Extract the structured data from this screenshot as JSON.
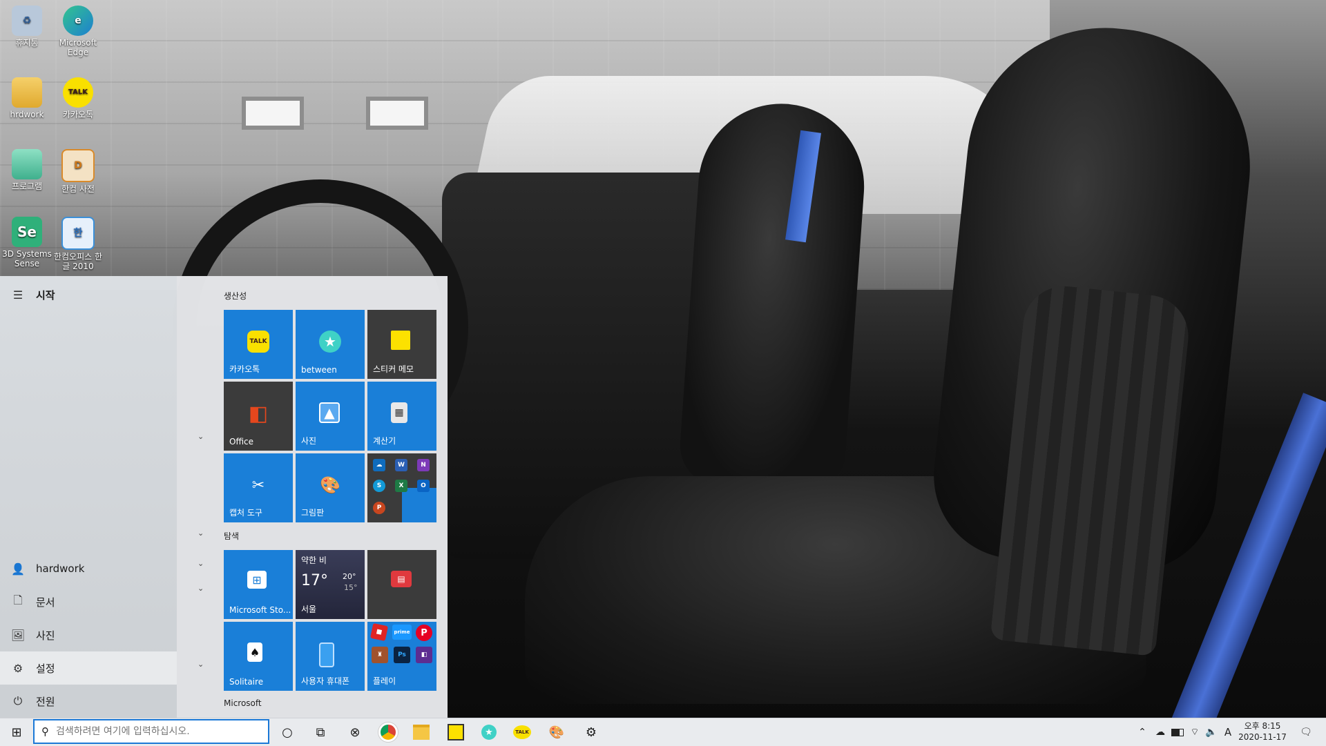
{
  "desktop": {
    "icons": [
      {
        "label": "휴지통",
        "glyph": "♻",
        "color": "#9fb7d3"
      },
      {
        "label": "Microsoft Edge",
        "glyph": "e",
        "color": "#1d7fcf"
      },
      {
        "label": "hrdwork",
        "glyph": "",
        "color": "#e7b948"
      },
      {
        "label": "카카오톡",
        "glyph": "TALK",
        "color": "#f9e000"
      },
      {
        "label": "프로그램",
        "glyph": "",
        "color": "#5cc6a7"
      },
      {
        "label": "한컴 사전",
        "glyph": "D",
        "color": "#d98a2a"
      },
      {
        "label": "3D Systems Sense",
        "glyph": "Se",
        "color": "#2fb07a"
      },
      {
        "label": "한컴오피스 한글 2010",
        "glyph": "한",
        "color": "#3a8fd8"
      }
    ]
  },
  "start_menu": {
    "header": {
      "label": "시작",
      "icon": "hamburger-icon"
    },
    "nav": [
      {
        "label": "hardwork",
        "icon": "user-icon"
      },
      {
        "label": "문서",
        "icon": "document-icon"
      },
      {
        "label": "사진",
        "icon": "pictures-icon"
      },
      {
        "label": "설정",
        "icon": "gear-icon"
      },
      {
        "label": "전원",
        "icon": "power-icon"
      }
    ],
    "groups": {
      "productivity": "생산성",
      "explore": "탐색",
      "microsoft": "Microsoft"
    },
    "tiles": {
      "kakaotalk": "카카오톡",
      "between": "between",
      "sticky": "스티커 메모",
      "office": "Office",
      "photos": "사진",
      "calculator": "계산기",
      "snipping": "캡처 도구",
      "paint": "그림판",
      "store": "Microsoft Sto...",
      "weather": {
        "condition": "약한 비",
        "temp": "17°",
        "high": "20°",
        "low": "15°",
        "city": "서울"
      },
      "news": "",
      "solitaire": "Solitaire",
      "phone": "사용자 휴대폰",
      "play": "플레이"
    },
    "office_minis": [
      "OneDrive",
      "Word",
      "OneNote",
      "Skype",
      "Excel",
      "Outlook",
      "PowerPoint"
    ],
    "play_minis": [
      "Roblox",
      "prime video",
      "Pinterest",
      "Game",
      "Photoshop",
      "Dolby"
    ]
  },
  "taskbar": {
    "search_placeholder": "검색하려면 여기에 입력하십시오.",
    "pinned": [
      "cortana-icon",
      "task-view-icon",
      "xbox-icon",
      "chrome-icon",
      "file-explorer-icon",
      "sticky-notes-icon",
      "between-icon",
      "kakaotalk-icon",
      "paint-icon",
      "settings-icon"
    ],
    "tray": {
      "ime": "A",
      "time": "오후 8:15",
      "date": "2020-11-17"
    }
  },
  "colors": {
    "tile_blue": "#1a7fd8",
    "tile_dark": "#3b3b3b",
    "search_border": "#1a78d6"
  }
}
